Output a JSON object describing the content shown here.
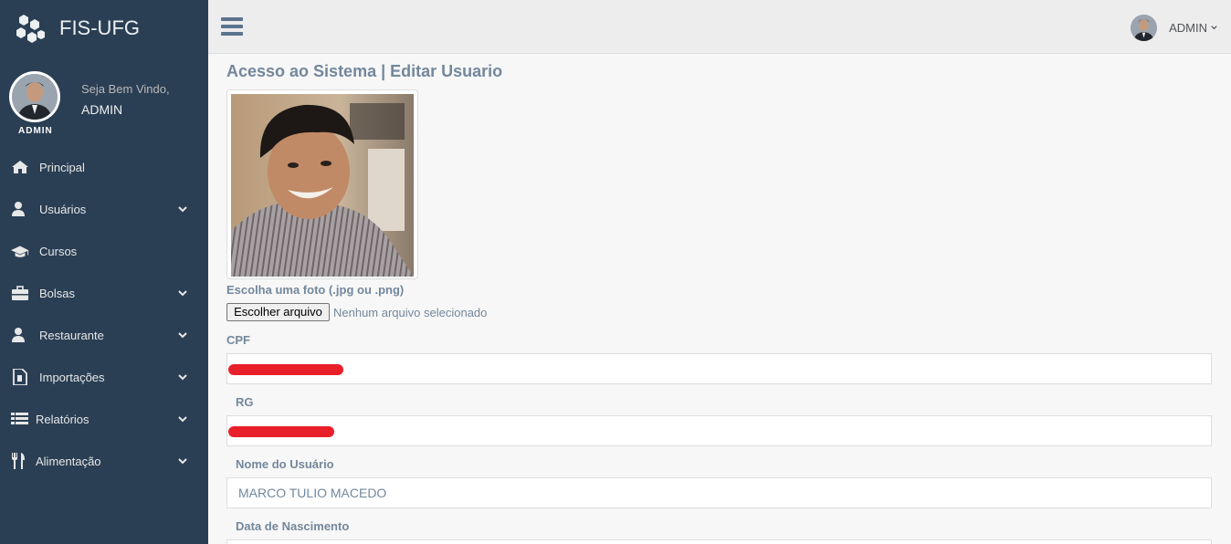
{
  "brand": {
    "title": "FIS-UFG"
  },
  "profile": {
    "welcome": "Seja Bem Vindo,",
    "username": "ADMIN",
    "badge": "ADMIN"
  },
  "menu": [
    {
      "label": "Principal",
      "icon": "home-icon",
      "has_submenu": false
    },
    {
      "label": "Usuários",
      "icon": "user-icon",
      "has_submenu": true
    },
    {
      "label": "Cursos",
      "icon": "graduation-cap-icon",
      "has_submenu": false
    },
    {
      "label": "Bolsas",
      "icon": "briefcase-icon",
      "has_submenu": true
    },
    {
      "label": "Restaurante",
      "icon": "user-icon",
      "has_submenu": true
    },
    {
      "label": "Importações",
      "icon": "file-icon",
      "has_submenu": true
    },
    {
      "label": "Relatórios",
      "icon": "list-icon",
      "has_submenu": true
    },
    {
      "label": "Alimentação",
      "icon": "cutlery-icon",
      "has_submenu": true
    }
  ],
  "topbar": {
    "user_name": "ADMIN"
  },
  "page": {
    "title": "Acesso ao Sistema | Editar Usuario",
    "photo_label": "Escolha uma foto (.jpg ou .png)",
    "file_button": "Escolher arquivo",
    "file_status": "Nenhum arquivo selecionado"
  },
  "form": {
    "cpf": {
      "label": "CPF",
      "value": ""
    },
    "rg": {
      "label": "RG",
      "value": ""
    },
    "nome": {
      "label": "Nome do Usuário",
      "value": "MARCO TULIO MACEDO"
    },
    "nascimento": {
      "label": "Data de Nascimento",
      "value": ""
    }
  },
  "colors": {
    "sidebar_bg": "#2a3f54",
    "topbar_bg": "#ededed",
    "content_bg": "#f7f7f7",
    "text": "#73879c",
    "redaction": "#e8202a"
  }
}
